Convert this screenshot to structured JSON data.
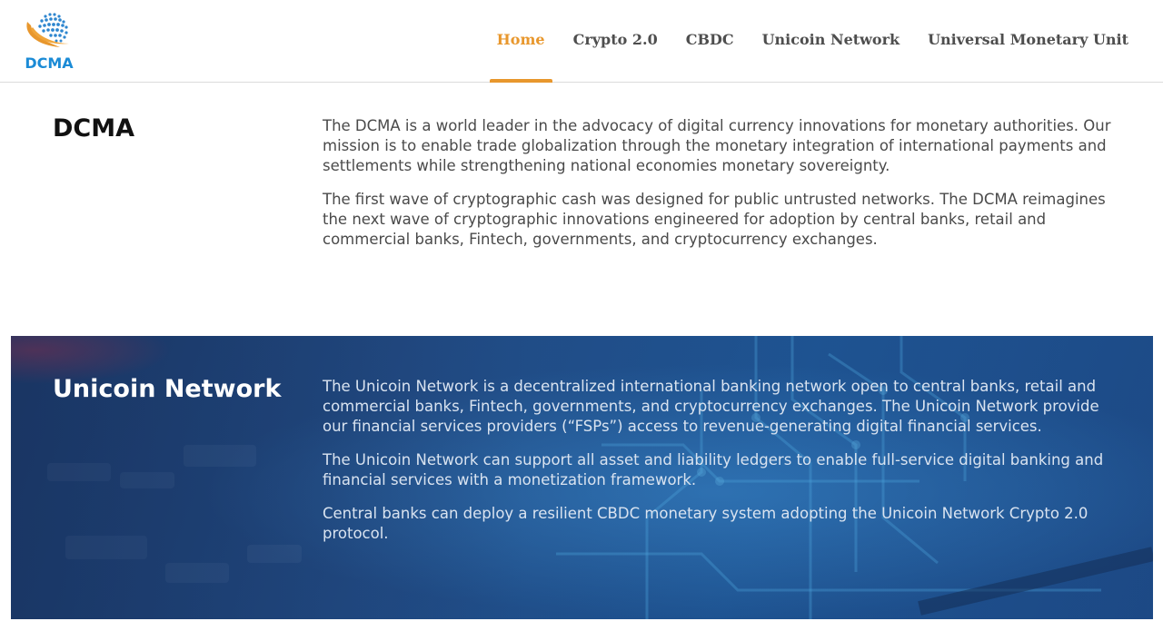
{
  "header": {
    "logo_text": "DCMA",
    "logo_icon": "globe-swoosh-icon",
    "nav": [
      {
        "label": "Home",
        "active": true
      },
      {
        "label": "Crypto 2.0",
        "active": false
      },
      {
        "label": "CBDC",
        "active": false
      },
      {
        "label": "Unicoin Network",
        "active": false
      },
      {
        "label": "Universal Monetary Unit",
        "active": false
      }
    ]
  },
  "dcma_section": {
    "title": "DCMA",
    "paragraphs": [
      "The DCMA is a world leader in the advocacy of digital currency innovations for monetary authorities. Our mission is to enable trade globalization through the monetary integration of international payments and settlements while strengthening national economies monetary sovereignty.",
      "The first wave of cryptographic cash was designed for public untrusted networks. The DCMA reimagines the next wave of cryptographic innovations engineered for adoption by central banks, retail and commercial banks, Fintech, governments, and cryptocurrency exchanges."
    ]
  },
  "unicoin_section": {
    "title": "Unicoin Network",
    "paragraphs": [
      "The Unicoin Network is a decentralized international banking network open to central banks, retail and commercial banks, Fintech, governments, and cryptocurrency exchanges. The Unicoin Network provide our financial services providers (“FSPs”) access to revenue-generating digital financial services.",
      "The Unicoin Network can support all asset and liability ledgers to enable full-service digital banking and financial services with a monetization framework.",
      "Central banks can deploy a resilient CBDC monetary system adopting the Unicoin Network Crypto 2.0 protocol."
    ]
  },
  "colors": {
    "accent": "#e8972d",
    "logo_blue": "#1b8bd6",
    "band_blue": "#24508a"
  }
}
